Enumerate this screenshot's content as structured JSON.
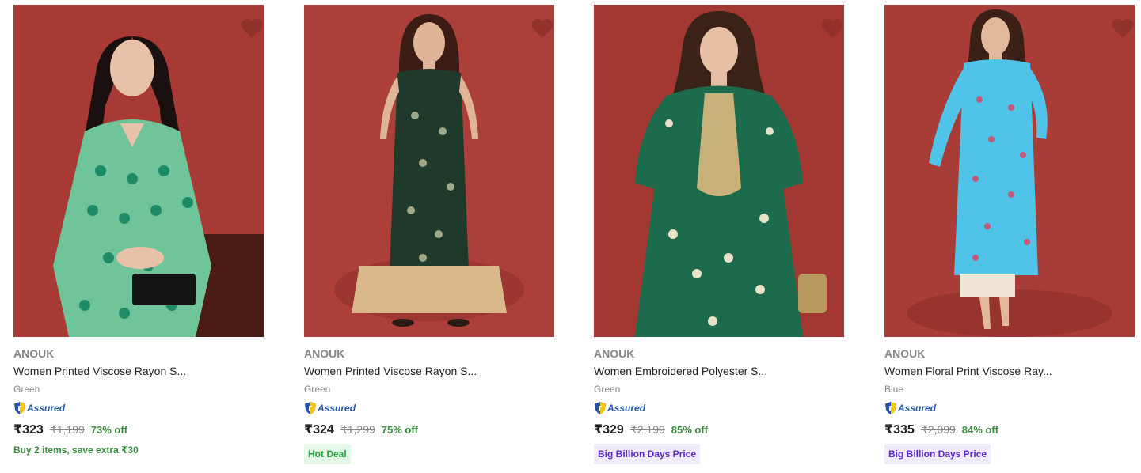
{
  "products": [
    {
      "brand": "ANOUK",
      "title": "Women Printed Viscose Rayon S...",
      "color": "Green",
      "assured": "Assured",
      "price": "₹323",
      "mrp": "₹1,199",
      "discount": "73% off",
      "offer": "Buy 2 items, save extra ₹30",
      "tag": "",
      "image_icon": "kurta-photo",
      "kurta_color": "#6fc49a",
      "bg_color": "#a83a35"
    },
    {
      "brand": "ANOUK",
      "title": "Women Printed Viscose Rayon S...",
      "color": "Green",
      "assured": "Assured",
      "price": "₹324",
      "mrp": "₹1,299",
      "discount": "75% off",
      "offer": "",
      "tag": "Hot Deal",
      "image_icon": "kurta-photo",
      "kurta_color": "#1f3a2a",
      "bg_color": "#ad3f3a"
    },
    {
      "brand": "ANOUK",
      "title": "Women Embroidered Polyester S...",
      "color": "Green",
      "assured": "Assured",
      "price": "₹329",
      "mrp": "₹2,199",
      "discount": "85% off",
      "offer": "",
      "tag": "Big Billion Days Price",
      "image_icon": "kurta-photo",
      "kurta_color": "#1c6b4c",
      "bg_color": "#a33832"
    },
    {
      "brand": "ANOUK",
      "title": "Women Floral Print Viscose Ray...",
      "color": "Blue",
      "assured": "Assured",
      "price": "₹335",
      "mrp": "₹2,099",
      "discount": "84% off",
      "offer": "",
      "tag": "Big Billion Days Price",
      "image_icon": "kurta-photo",
      "kurta_color": "#4fc3e8",
      "bg_color": "#a83c37"
    }
  ],
  "colors": {
    "discount_green": "#388e3c",
    "hot_deal_bg": "#e5f8e8",
    "bbd_bg": "#f1ecfd",
    "bbd_text": "#5a2bd4",
    "assured_blue": "#2455a8"
  }
}
